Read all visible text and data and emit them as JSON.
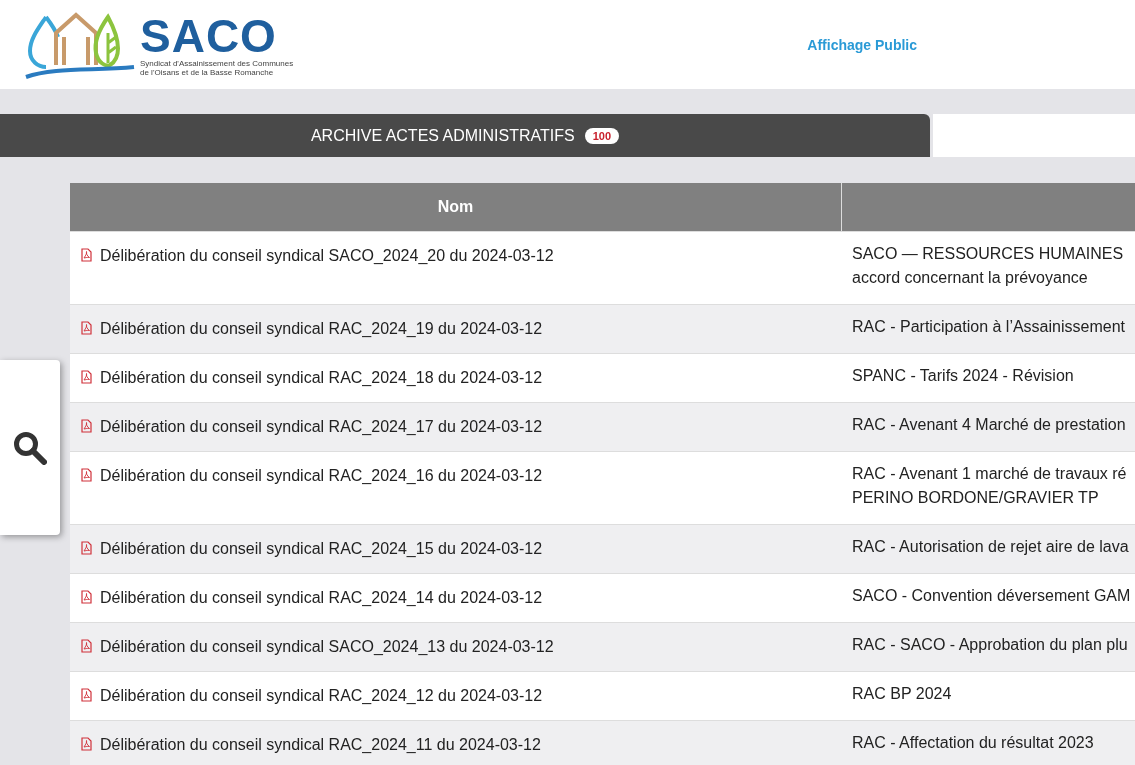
{
  "logo": {
    "name": "SACO",
    "subtitle": [
      "Syndicat d'Assainissement des Communes",
      "de l'Oisans et de la Basse Romanche"
    ]
  },
  "nav": {
    "link": "Affichage Public"
  },
  "tabs": [
    {
      "label": "ARCHIVE ACTES ADMINISTRATIFS",
      "count": "100",
      "selected": true
    }
  ],
  "table": {
    "columns": [
      "Nom"
    ],
    "rows": [
      {
        "name": "Délibération du conseil syndical SACO_2024_20 du 2024-03-12",
        "description": [
          "SACO — RESSOURCES HUMAINES",
          "accord concernant la prévoyance"
        ]
      },
      {
        "name": "Délibération du conseil syndical RAC_2024_19 du 2024-03-12",
        "description": [
          "RAC - Participation à l’Assainissement"
        ]
      },
      {
        "name": "Délibération du conseil syndical RAC_2024_18 du 2024-03-12",
        "description": [
          "SPANC - Tarifs 2024 - Révision"
        ]
      },
      {
        "name": "Délibération du conseil syndical RAC_2024_17 du 2024-03-12",
        "description": [
          "RAC - Avenant 4 Marché de prestation"
        ]
      },
      {
        "name": "Délibération du conseil syndical RAC_2024_16 du 2024-03-12",
        "description": [
          "RAC - Avenant 1 marché de travaux ré",
          "PERINO BORDONE/GRAVIER TP"
        ]
      },
      {
        "name": "Délibération du conseil syndical RAC_2024_15 du 2024-03-12",
        "description": [
          "RAC - Autorisation de rejet aire de lava"
        ]
      },
      {
        "name": "Délibération du conseil syndical RAC_2024_14 du 2024-03-12",
        "description": [
          "SACO - Convention déversement GAM"
        ]
      },
      {
        "name": "Délibération du conseil syndical SACO_2024_13 du 2024-03-12",
        "description": [
          "RAC - SACO - Approbation du plan plu"
        ]
      },
      {
        "name": "Délibération du conseil syndical RAC_2024_12 du 2024-03-12",
        "description": [
          "RAC BP 2024"
        ]
      },
      {
        "name": "Délibération du conseil syndical RAC_2024_11 du 2024-03-12",
        "description": [
          "RAC - Affectation du résultat 2023"
        ]
      }
    ]
  }
}
